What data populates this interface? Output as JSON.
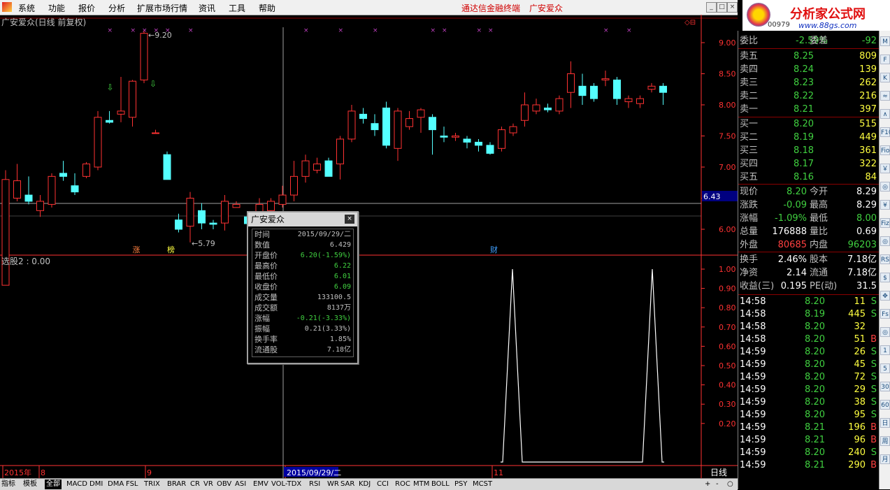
{
  "menubar": {
    "items": [
      "系统",
      "功能",
      "报价",
      "分析",
      "扩展市场行情",
      "资讯",
      "工具",
      "帮助"
    ],
    "center_title": "通达信金融终端",
    "stock_name": "广安爱众",
    "right_partial": "行"
  },
  "logo": {
    "title": "分析家公式网",
    "url": "www.88gs.com",
    "partial_code": "00979"
  },
  "chart": {
    "header": "广安爱众(日线 前复权)",
    "price_axis": [
      "9.00",
      "8.50",
      "8.00",
      "7.50",
      "7.00",
      "6.50",
      "6.00"
    ],
    "price_label": "6.43",
    "high_mark": "9.20",
    "low_mark": "5.79",
    "event_tags": [
      "涨",
      "榜",
      "财"
    ],
    "indicator_header": "选股2 : 0.00",
    "indicator_axis": [
      "1.00",
      "0.90",
      "0.80",
      "0.70",
      "0.60",
      "0.50",
      "0.40",
      "0.30",
      "0.20"
    ],
    "date_axis": [
      "2015年",
      "8",
      "9",
      "2015/09/29/二",
      "11"
    ],
    "period_label": "日线",
    "candles": [
      [
        5.1,
        6.95,
        6.6,
        6.8
      ],
      [
        6.5,
        7.05,
        6.45,
        6.78
      ],
      [
        6.55,
        6.85,
        6.4,
        6.45
      ],
      [
        6.3,
        6.55,
        6.2,
        6.45
      ],
      [
        6.4,
        6.9,
        6.35,
        6.85
      ],
      [
        6.9,
        7.1,
        6.78,
        6.85
      ],
      [
        6.7,
        6.9,
        6.55,
        6.6
      ],
      [
        6.85,
        7.08,
        6.82,
        7.05
      ],
      [
        7.0,
        7.9,
        6.95,
        7.8
      ],
      [
        7.75,
        7.9,
        7.7,
        7.72
      ],
      [
        7.85,
        8.45,
        7.72,
        7.9
      ],
      [
        7.8,
        8.4,
        7.65,
        8.38
      ],
      [
        8.4,
        9.2,
        8.35,
        9.15
      ],
      [
        7.55,
        7.6,
        7.55,
        7.55
      ],
      [
        7.2,
        7.25,
        6.8,
        6.8
      ],
      [
        6.15,
        6.25,
        5.95,
        6.0
      ],
      [
        6.05,
        6.6,
        5.79,
        6.5
      ],
      [
        6.3,
        6.42,
        6.0,
        6.1
      ],
      [
        6.1,
        6.15,
        6.0,
        6.08
      ],
      [
        6.1,
        6.55,
        5.98,
        6.45
      ],
      [
        6.35,
        6.45,
        6.35,
        6.4
      ],
      [
        6.2,
        6.22,
        6.01,
        6.09
      ],
      [
        6.1,
        6.5,
        6.05,
        6.4
      ],
      [
        6.3,
        6.5,
        6.25,
        6.45
      ],
      [
        6.4,
        6.7,
        6.35,
        6.55
      ],
      [
        6.55,
        7.1,
        6.45,
        6.85
      ],
      [
        6.85,
        7.2,
        6.75,
        7.1
      ],
      [
        6.95,
        7.15,
        6.9,
        7.05
      ],
      [
        7.1,
        7.15,
        6.85,
        6.85
      ],
      [
        7.05,
        7.5,
        6.8,
        7.45
      ],
      [
        7.45,
        8.0,
        7.4,
        7.9
      ],
      [
        7.85,
        7.95,
        7.7,
        7.78
      ],
      [
        7.7,
        7.85,
        7.5,
        7.6
      ],
      [
        7.95,
        8.05,
        7.3,
        7.35
      ],
      [
        7.3,
        7.95,
        7.1,
        7.9
      ],
      [
        7.65,
        7.9,
        7.6,
        7.78
      ],
      [
        7.8,
        7.95,
        7.55,
        7.92
      ],
      [
        7.8,
        7.85,
        7.2,
        7.6
      ],
      [
        7.5,
        7.65,
        7.4,
        7.48
      ],
      [
        7.48,
        7.55,
        7.42,
        7.5
      ],
      [
        7.45,
        7.5,
        7.3,
        7.4
      ],
      [
        7.4,
        7.45,
        7.25,
        7.35
      ],
      [
        7.35,
        7.4,
        7.2,
        7.22
      ],
      [
        7.3,
        7.65,
        7.25,
        7.6
      ],
      [
        7.55,
        7.7,
        7.5,
        7.65
      ],
      [
        7.75,
        8.2,
        7.65,
        8.0
      ],
      [
        7.9,
        8.1,
        7.85,
        8.0
      ],
      [
        7.95,
        8.02,
        7.88,
        7.92
      ],
      [
        7.9,
        8.15,
        7.85,
        8.1
      ],
      [
        8.2,
        8.7,
        7.95,
        8.5
      ],
      [
        8.3,
        8.5,
        8.0,
        8.15
      ],
      [
        8.3,
        8.35,
        8.05,
        8.1
      ],
      [
        8.4,
        8.55,
        8.3,
        8.42
      ],
      [
        8.4,
        8.45,
        8.0,
        8.1
      ],
      [
        8.05,
        8.15,
        7.95,
        8.1
      ],
      [
        8.02,
        8.15,
        7.95,
        8.1
      ],
      [
        8.25,
        8.35,
        8.2,
        8.3
      ],
      [
        8.3,
        8.35,
        8.0,
        8.2
      ]
    ],
    "signal_peaks": [
      36,
      46
    ]
  },
  "tooltip": {
    "title": "广安爱众",
    "rows": [
      {
        "k": "时间",
        "v": "2015/09/29/二",
        "c": "#c0c0c0"
      },
      {
        "k": "数值",
        "v": "6.429",
        "c": "#c0c0c0"
      },
      {
        "k": "开盘价",
        "v": "6.20(-1.59%)",
        "c": "#40d040"
      },
      {
        "k": "最高价",
        "v": "6.22",
        "c": "#40d040"
      },
      {
        "k": "最低价",
        "v": "6.01",
        "c": "#40d040"
      },
      {
        "k": "收盘价",
        "v": "6.09",
        "c": "#40d040"
      },
      {
        "k": "成交量",
        "v": "133100.5",
        "c": "#c0c0c0"
      },
      {
        "k": "成交额",
        "v": "8137万",
        "c": "#c0c0c0"
      },
      {
        "k": "涨幅",
        "v": "-0.21(-3.33%)",
        "c": "#40d040"
      },
      {
        "k": "振幅",
        "v": "0.21(3.33%)",
        "c": "#c0c0c0"
      },
      {
        "k": "换手率",
        "v": "1.85%",
        "c": "#c0c0c0"
      },
      {
        "k": "流通股",
        "v": "7.18亿",
        "c": "#c0c0c0"
      }
    ]
  },
  "quote": {
    "weibi": {
      "k1": "委比",
      "v1": "-2.59%",
      "k2": "委差",
      "v2": "-92"
    },
    "asks": [
      {
        "k": "卖五",
        "p": "8.25",
        "v": "809"
      },
      {
        "k": "卖四",
        "p": "8.24",
        "v": "139"
      },
      {
        "k": "卖三",
        "p": "8.23",
        "v": "262"
      },
      {
        "k": "卖二",
        "p": "8.22",
        "v": "216"
      },
      {
        "k": "卖一",
        "p": "8.21",
        "v": "397"
      }
    ],
    "bids": [
      {
        "k": "买一",
        "p": "8.20",
        "v": "515"
      },
      {
        "k": "买二",
        "p": "8.19",
        "v": "449"
      },
      {
        "k": "买三",
        "p": "8.18",
        "v": "361"
      },
      {
        "k": "买四",
        "p": "8.17",
        "v": "322"
      },
      {
        "k": "买五",
        "p": "8.16",
        "v": "84"
      }
    ],
    "stats": [
      {
        "k1": "现价",
        "v1": "8.20",
        "c1": "#40d040",
        "k2": "今开",
        "v2": "8.29",
        "c2": "#ffffff"
      },
      {
        "k1": "涨跌",
        "v1": "-0.09",
        "c1": "#40d040",
        "k2": "最高",
        "v2": "8.29",
        "c2": "#ffffff"
      },
      {
        "k1": "涨幅",
        "v1": "-1.09%",
        "c1": "#40d040",
        "k2": "最低",
        "v2": "8.00",
        "c2": "#40d040"
      },
      {
        "k1": "总量",
        "v1": "176888",
        "c1": "#ffffff",
        "k2": "量比",
        "v2": "0.69",
        "c2": "#ffffff"
      },
      {
        "k1": "外盘",
        "v1": "80685",
        "c1": "#ff4040",
        "k2": "内盘",
        "v2": "96203",
        "c2": "#40d040"
      }
    ],
    "stats2": [
      {
        "k1": "换手",
        "v1": "2.46%",
        "k2": "股本",
        "v2": "7.18亿"
      },
      {
        "k1": "净资",
        "v1": "2.14",
        "k2": "流通",
        "v2": "7.18亿"
      },
      {
        "k1": "收益(三)",
        "v1": "0.195",
        "k2": "PE(动)",
        "v2": "31.5"
      }
    ],
    "ticks": [
      {
        "t": "14:58",
        "p": "8.20",
        "v": "11",
        "s": "S"
      },
      {
        "t": "14:58",
        "p": "8.19",
        "v": "445",
        "s": "S"
      },
      {
        "t": "14:58",
        "p": "8.20",
        "v": "32",
        "s": ""
      },
      {
        "t": "14:58",
        "p": "8.20",
        "v": "51",
        "s": "B"
      },
      {
        "t": "14:59",
        "p": "8.20",
        "v": "26",
        "s": "S"
      },
      {
        "t": "14:59",
        "p": "8.20",
        "v": "45",
        "s": "S"
      },
      {
        "t": "14:59",
        "p": "8.20",
        "v": "72",
        "s": "S"
      },
      {
        "t": "14:59",
        "p": "8.20",
        "v": "29",
        "s": "S"
      },
      {
        "t": "14:59",
        "p": "8.20",
        "v": "38",
        "s": "S"
      },
      {
        "t": "14:59",
        "p": "8.20",
        "v": "95",
        "s": "S"
      },
      {
        "t": "14:59",
        "p": "8.21",
        "v": "196",
        "s": "B"
      },
      {
        "t": "14:59",
        "p": "8.21",
        "v": "96",
        "s": "B"
      },
      {
        "t": "14:59",
        "p": "8.20",
        "v": "240",
        "s": "S"
      },
      {
        "t": "14:59",
        "p": "8.21",
        "v": "290",
        "s": "B"
      }
    ]
  },
  "toolbar": [
    "M",
    "F",
    "K",
    "≈",
    "∧",
    "F10",
    "Fio",
    "￥",
    "◎",
    "¥",
    "Fiz",
    "◎",
    "RSI",
    "$",
    "✥",
    "Fs",
    "◎",
    "1",
    "5",
    "30",
    "60",
    "日",
    "周",
    "月"
  ],
  "tabs": [
    "指标",
    "模板",
    "全部",
    "MACD",
    "DMI",
    "DMA",
    "FSL",
    "TRIX",
    "BRAR",
    "CR",
    "VR",
    "OBV",
    "ASI",
    "EMV",
    "VOL-TDX",
    "RSI",
    "WR",
    "SAR",
    "KDJ",
    "CCI",
    "ROC",
    "MTM",
    "BOLL",
    "PSY",
    "MCST"
  ],
  "tabs_right": [
    "+",
    "-",
    "○"
  ],
  "colors": {
    "up": "#ff3232",
    "down": "#54ffff",
    "axis": "#ff3232",
    "text": "#c0c0c0",
    "green": "#40d040"
  }
}
